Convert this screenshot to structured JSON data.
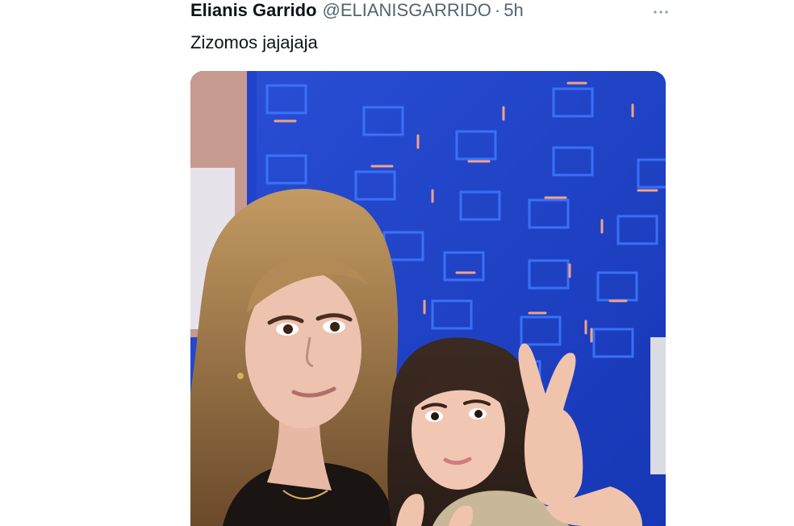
{
  "tweet": {
    "author_name": "Elianis Garrido",
    "author_handle": "@ELIANISGARRIDO",
    "separator": "·",
    "timestamp": "5h",
    "text": "Zizomos jajajaja",
    "more_icon": "more-horizontal-icon",
    "media": {
      "type": "photo",
      "background_color": "#1f43c8",
      "pattern_color": "#3a6bff",
      "accent_color": "#f2a187"
    }
  }
}
